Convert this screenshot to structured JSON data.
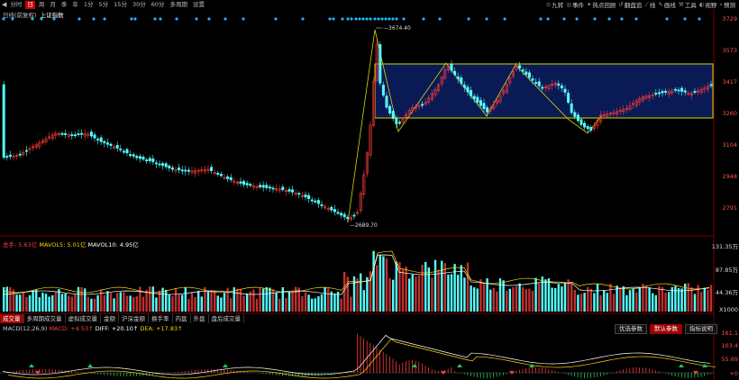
{
  "toolbar": {
    "back_icon": "back-arrow-icon",
    "periods": [
      "分时",
      "日",
      "周",
      "月",
      "季",
      "年",
      "1分",
      "5分",
      "15分",
      "30分",
      "60分",
      "多周期",
      "设置"
    ],
    "active_period": "日",
    "right_items": [
      {
        "icon": "zoom-icon",
        "label": "九转"
      },
      {
        "icon": "event-icon",
        "label": "事件"
      },
      {
        "icon": "hotspot-icon",
        "label": "热点回顾"
      },
      {
        "icon": "review-icon",
        "label": "翻盘追"
      },
      {
        "icon": "draw-icon",
        "label": "线"
      },
      {
        "icon": "pen-icon",
        "label": "画线"
      },
      {
        "icon": "tool-icon",
        "label": "工具"
      },
      {
        "icon": "vision-icon",
        "label": "视野"
      },
      {
        "icon": "search-icon",
        "label": "预测"
      }
    ]
  },
  "main_chart": {
    "period_label": "日线(前复权)",
    "stock_name": "上证指数",
    "high_label": "3674.40",
    "low_label": "2689.70",
    "price_ticks": [
      "3729",
      "3573",
      "3417",
      "3260",
      "3104",
      "2948",
      "2791"
    ],
    "colors": {
      "up": "#ff3b3b",
      "down": "#54ffff",
      "box_fill": "#0a1a55",
      "box_border": "#d8d800",
      "zigzag": "#d8d800",
      "signal": "#1fb6ff"
    }
  },
  "volume": {
    "legend_label": "总手:",
    "legend_value": "5.63亿",
    "mavol5": "MAVOL5: 5.01亿",
    "mavol10": "MAVOL10: 4.95亿",
    "ticks": [
      "131.35万",
      "87.85万",
      "44.36万",
      "X1000"
    ]
  },
  "indicator_tabs": [
    "成交量",
    "多周期成交量",
    "虚拟成交量",
    "金额",
    "沪深金额",
    "换手率",
    "内盘",
    "外盘",
    "盘后成交量"
  ],
  "active_indicator_tab": "成交量",
  "macd": {
    "title": "MACD(12,26,9)",
    "macd_value": "MACD: +4.53↑",
    "diff": "DIFF: +20.10↑",
    "dea": "DEA: +17.83↑",
    "ticks": [
      "161.1",
      "103.4",
      "55.69",
      "+0"
    ],
    "buttons": [
      "优选参数",
      "默认参数",
      "指标说明"
    ],
    "active_button": "默认参数"
  }
}
